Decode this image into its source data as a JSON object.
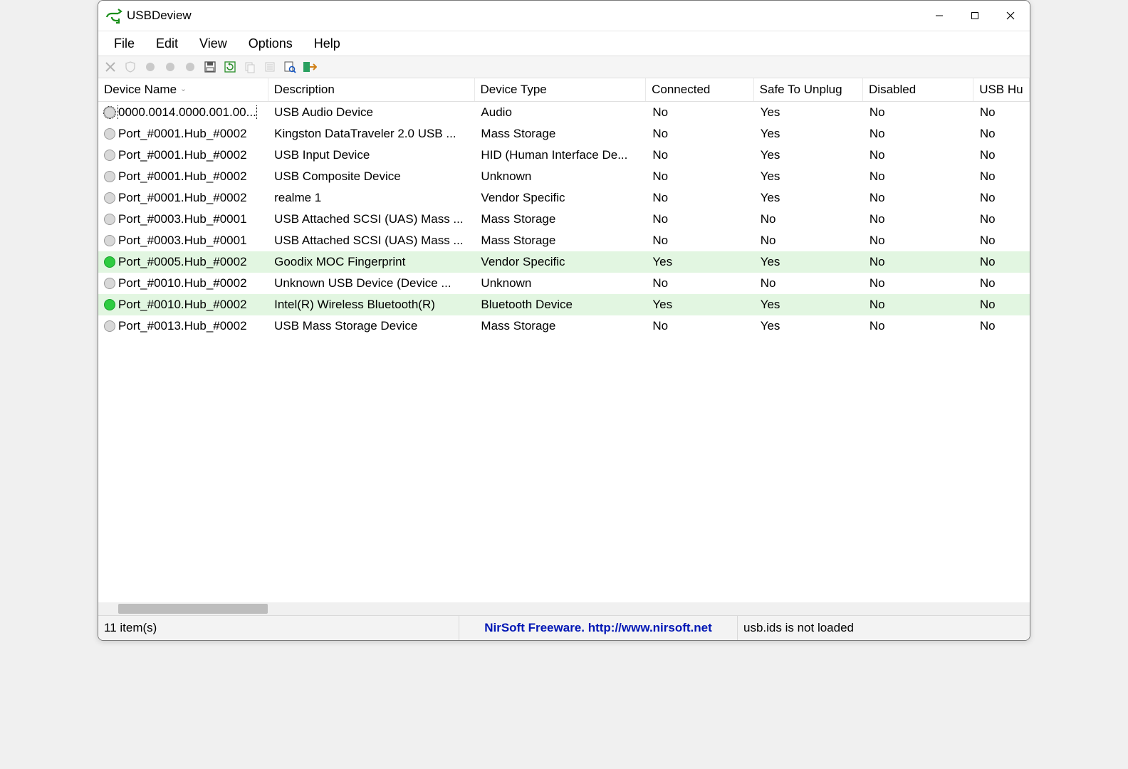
{
  "window": {
    "title": "USBDeview"
  },
  "menu": [
    "File",
    "Edit",
    "View",
    "Options",
    "Help"
  ],
  "toolbar": [
    {
      "name": "delete-icon",
      "disabled": true
    },
    {
      "name": "shield-icon",
      "disabled": true
    },
    {
      "name": "led-red-icon",
      "disabled": true
    },
    {
      "name": "led-green-icon",
      "disabled": true
    },
    {
      "name": "led-blue-icon",
      "disabled": true
    },
    {
      "name": "save-icon",
      "disabled": false
    },
    {
      "name": "refresh-icon",
      "disabled": false
    },
    {
      "name": "copy-icon",
      "disabled": true
    },
    {
      "name": "properties-icon",
      "disabled": true
    },
    {
      "name": "find-icon",
      "disabled": false
    },
    {
      "name": "exit-icon",
      "disabled": false
    }
  ],
  "columns": [
    {
      "label": "Device Name",
      "sorted": true
    },
    {
      "label": "Description"
    },
    {
      "label": "Device Type"
    },
    {
      "label": "Connected"
    },
    {
      "label": "Safe To Unplug"
    },
    {
      "label": "Disabled"
    },
    {
      "label": "USB Hu"
    }
  ],
  "rows": [
    {
      "connected": false,
      "selected": true,
      "cells": [
        "0000.0014.0000.001.00...",
        "USB Audio Device",
        "Audio",
        "No",
        "Yes",
        "No",
        "No"
      ]
    },
    {
      "connected": false,
      "cells": [
        "Port_#0001.Hub_#0002",
        "Kingston DataTraveler 2.0 USB ...",
        "Mass Storage",
        "No",
        "Yes",
        "No",
        "No"
      ]
    },
    {
      "connected": false,
      "cells": [
        "Port_#0001.Hub_#0002",
        "USB Input Device",
        "HID (Human Interface De...",
        "No",
        "Yes",
        "No",
        "No"
      ]
    },
    {
      "connected": false,
      "cells": [
        "Port_#0001.Hub_#0002",
        "USB Composite Device",
        "Unknown",
        "No",
        "Yes",
        "No",
        "No"
      ]
    },
    {
      "connected": false,
      "cells": [
        "Port_#0001.Hub_#0002",
        "realme 1",
        "Vendor Specific",
        "No",
        "Yes",
        "No",
        "No"
      ]
    },
    {
      "connected": false,
      "cells": [
        "Port_#0003.Hub_#0001",
        "USB Attached SCSI (UAS) Mass ...",
        "Mass Storage",
        "No",
        "No",
        "No",
        "No"
      ]
    },
    {
      "connected": false,
      "cells": [
        "Port_#0003.Hub_#0001",
        "USB Attached SCSI (UAS) Mass ...",
        "Mass Storage",
        "No",
        "No",
        "No",
        "No"
      ]
    },
    {
      "connected": true,
      "cells": [
        "Port_#0005.Hub_#0002",
        "Goodix MOC Fingerprint",
        "Vendor Specific",
        "Yes",
        "Yes",
        "No",
        "No"
      ]
    },
    {
      "connected": false,
      "cells": [
        "Port_#0010.Hub_#0002",
        "Unknown USB Device (Device ...",
        "Unknown",
        "No",
        "No",
        "No",
        "No"
      ]
    },
    {
      "connected": true,
      "cells": [
        "Port_#0010.Hub_#0002",
        "Intel(R) Wireless Bluetooth(R)",
        "Bluetooth Device",
        "Yes",
        "Yes",
        "No",
        "No"
      ]
    },
    {
      "connected": false,
      "cells": [
        "Port_#0013.Hub_#0002",
        "USB Mass Storage Device",
        "Mass Storage",
        "No",
        "Yes",
        "No",
        "No"
      ]
    }
  ],
  "status": {
    "count": "11 item(s)",
    "center": "NirSoft Freeware.  http://www.nirsoft.net",
    "right": "usb.ids is not loaded"
  }
}
